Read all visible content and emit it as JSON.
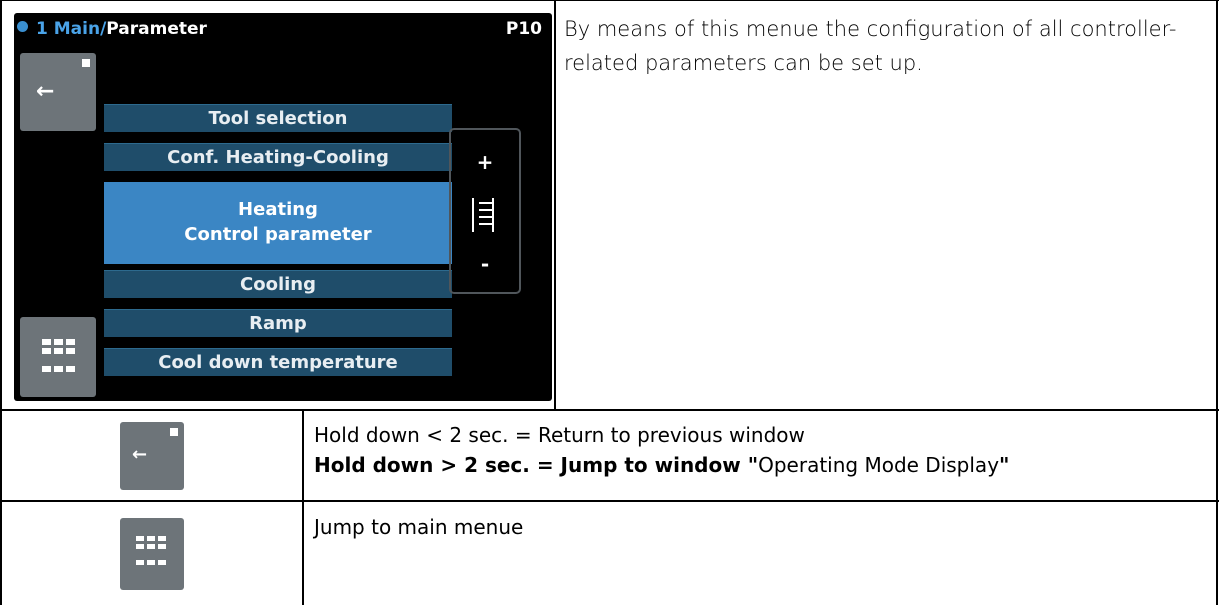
{
  "screen": {
    "breadcrumb_prefix": "1 Main/",
    "breadcrumb_current": "Parameter",
    "page_code": "P10",
    "menu_items": [
      {
        "label": "Tool selection"
      },
      {
        "label": "Conf. Heating-Cooling"
      },
      {
        "label_line1": "Heating",
        "label_line2": "Control parameter",
        "selected": true
      },
      {
        "label": "Cooling"
      },
      {
        "label": "Ramp"
      },
      {
        "label": "Cool down temperature"
      }
    ],
    "scroll_plus": "+",
    "scroll_minus": "-",
    "back_arrow": "←"
  },
  "description": "By means of this menue the configuration of all controller-related parameters can be set up.",
  "rows": [
    {
      "icon": "back-button-icon",
      "line1": "Hold down < 2 sec. = Return to previous window",
      "line2_bold": "Hold down > 2 sec. = Jump to window ",
      "line2_quote_open": "\"",
      "line2_light": "Operating Mode Display",
      "line2_quote_close": "\""
    },
    {
      "icon": "main-menu-grid-icon",
      "text": "Jump to main menue"
    }
  ],
  "colors": {
    "accent_blue": "#3b86c4",
    "item_dark_blue": "#1f4d6a",
    "button_grey": "#6d7479"
  }
}
